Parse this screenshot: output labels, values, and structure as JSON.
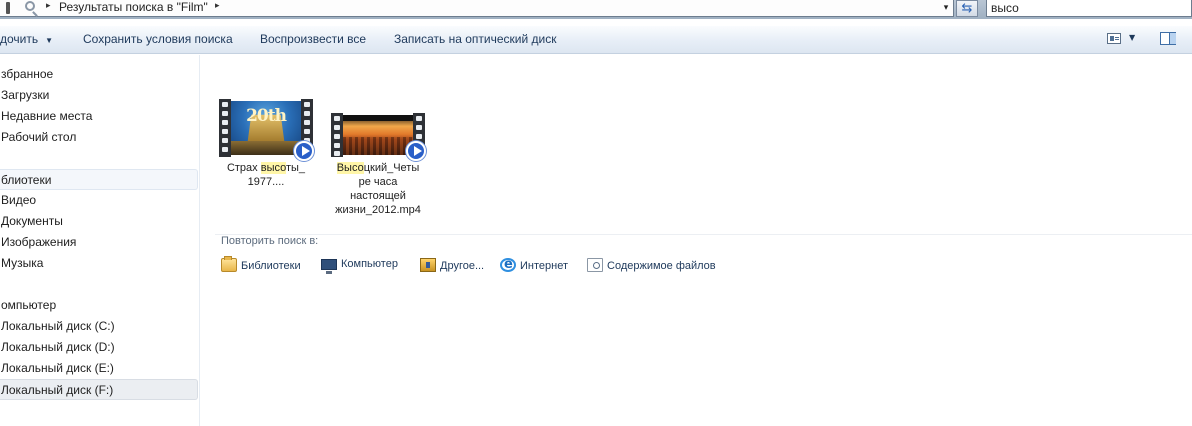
{
  "address": {
    "breadcrumb": "Результаты поиска в \"Film\"",
    "separator": "▸",
    "dropdown": "▾"
  },
  "search": {
    "value": "высо"
  },
  "toolbar": {
    "items": [
      {
        "label": "Упорядочить",
        "visible_label": "дочить",
        "has_caret": true
      },
      {
        "label": "Сохранить условия поиска"
      },
      {
        "label": "Воспроизвести все"
      },
      {
        "label": "Записать на оптический диск"
      }
    ],
    "caret": "▼",
    "views_caret": "▼"
  },
  "nav": {
    "items": [
      {
        "label": "збранное"
      },
      {
        "label": "Загрузки"
      },
      {
        "label": "Недавние места"
      },
      {
        "label": "Рабочий стол"
      },
      {
        "label": "блиотеки"
      },
      {
        "label": "Видео"
      },
      {
        "label": "Документы"
      },
      {
        "label": "Изображения"
      },
      {
        "label": "Музыка"
      },
      {
        "label": "омпьютер"
      },
      {
        "label": "Локальный диск (C:)"
      },
      {
        "label": "Локальный диск (D:)"
      },
      {
        "label": "Локальный диск (E:)"
      },
      {
        "label": "Локальный диск (F:)"
      }
    ]
  },
  "files": [
    {
      "name_pre": "Страх ",
      "name_hl": "высо",
      "name_post": "ты_",
      "name_line2": "1977....",
      "thumbnail": "fox-logo-frame",
      "overlay_icon": "play-icon"
    },
    {
      "name_hl": "Высо",
      "name_post": "цкий_Четы",
      "name_line2": "ре часа",
      "name_line3": "настоящей",
      "name_line4": "жизни_2012.mp4",
      "thumbnail": "sunset-frame",
      "overlay_icon": "play-icon"
    }
  ],
  "repeat_search": {
    "title": "Повторить поиск в:",
    "links": [
      {
        "label": "Библиотеки",
        "icon": "libraries-icon"
      },
      {
        "label": "Компьютер",
        "icon": "computer-icon"
      },
      {
        "label": "Другое...",
        "icon": "custom-folder-icon"
      },
      {
        "label": "Интернет",
        "icon": "internet-icon"
      },
      {
        "label": "Содержимое файлов",
        "icon": "file-contents-icon"
      }
    ]
  },
  "colors": {
    "highlight": "#fff6a8",
    "command_text": "#1e395b",
    "play_badge": "#2a5fc8"
  }
}
